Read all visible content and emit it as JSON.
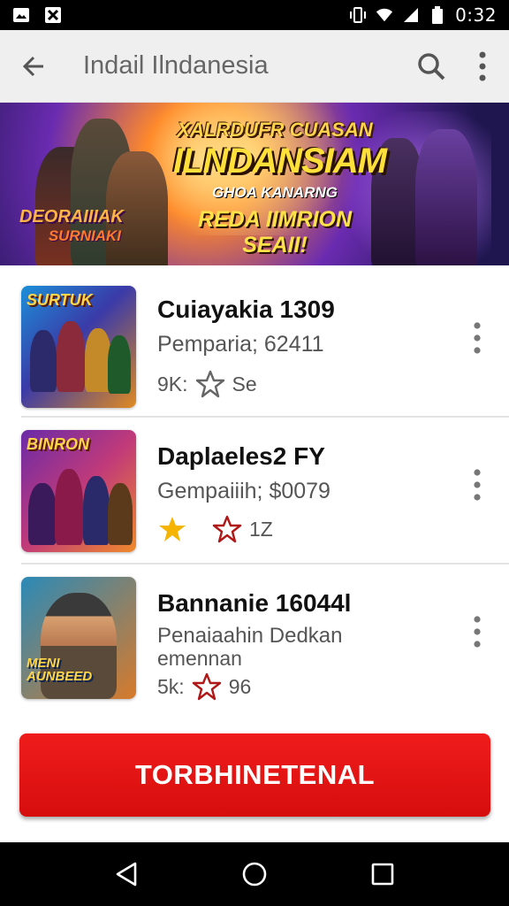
{
  "status_bar": {
    "time": "0:32",
    "icons": [
      "image-icon",
      "x-box-icon",
      "vibrate-icon",
      "wifi-icon",
      "signal-icon",
      "battery-icon"
    ]
  },
  "app_bar": {
    "title": "Indail Ilndanesia",
    "icons": [
      "back-arrow-icon",
      "search-icon",
      "more-vert-icon"
    ]
  },
  "banner": {
    "line1": "XALRDUFR CUASAN",
    "line2": "ILNDANSIAM",
    "line3": "GHOA KANARNG",
    "line4": "REDA IIMRION SEAII!",
    "logo_line1": "DEORAIIIAK",
    "logo_line2": "SURNIAKI"
  },
  "list": {
    "items": [
      {
        "thumb_label": "SURTUK",
        "title": "Cuiayakia 1309",
        "subtitle": "Pemparia; 62411",
        "meta_prefix": "9K:",
        "meta_suffix": "Se",
        "star_filled": false
      },
      {
        "thumb_label": "BINRON",
        "title": "Daplaeles2 FY",
        "subtitle": "Gempaiiih; $0079",
        "meta_prefix": "",
        "meta_suffix": "1Z",
        "star_filled": true
      },
      {
        "thumb_label": "MENI\nAUNBEED",
        "title": "Bannanie 16044l",
        "subtitle": "Penaiaahin Dedkan",
        "subtitle2": "emennan",
        "meta_prefix": "5k:",
        "meta_suffix": "96",
        "star_filled": false
      }
    ]
  },
  "primary_button": {
    "label": "TORBHINETENAL"
  },
  "colors": {
    "primary_red": "#e31414",
    "app_bar_bg": "#efefef",
    "star_outline": "#b01818",
    "star_gold": "#f5b400"
  }
}
